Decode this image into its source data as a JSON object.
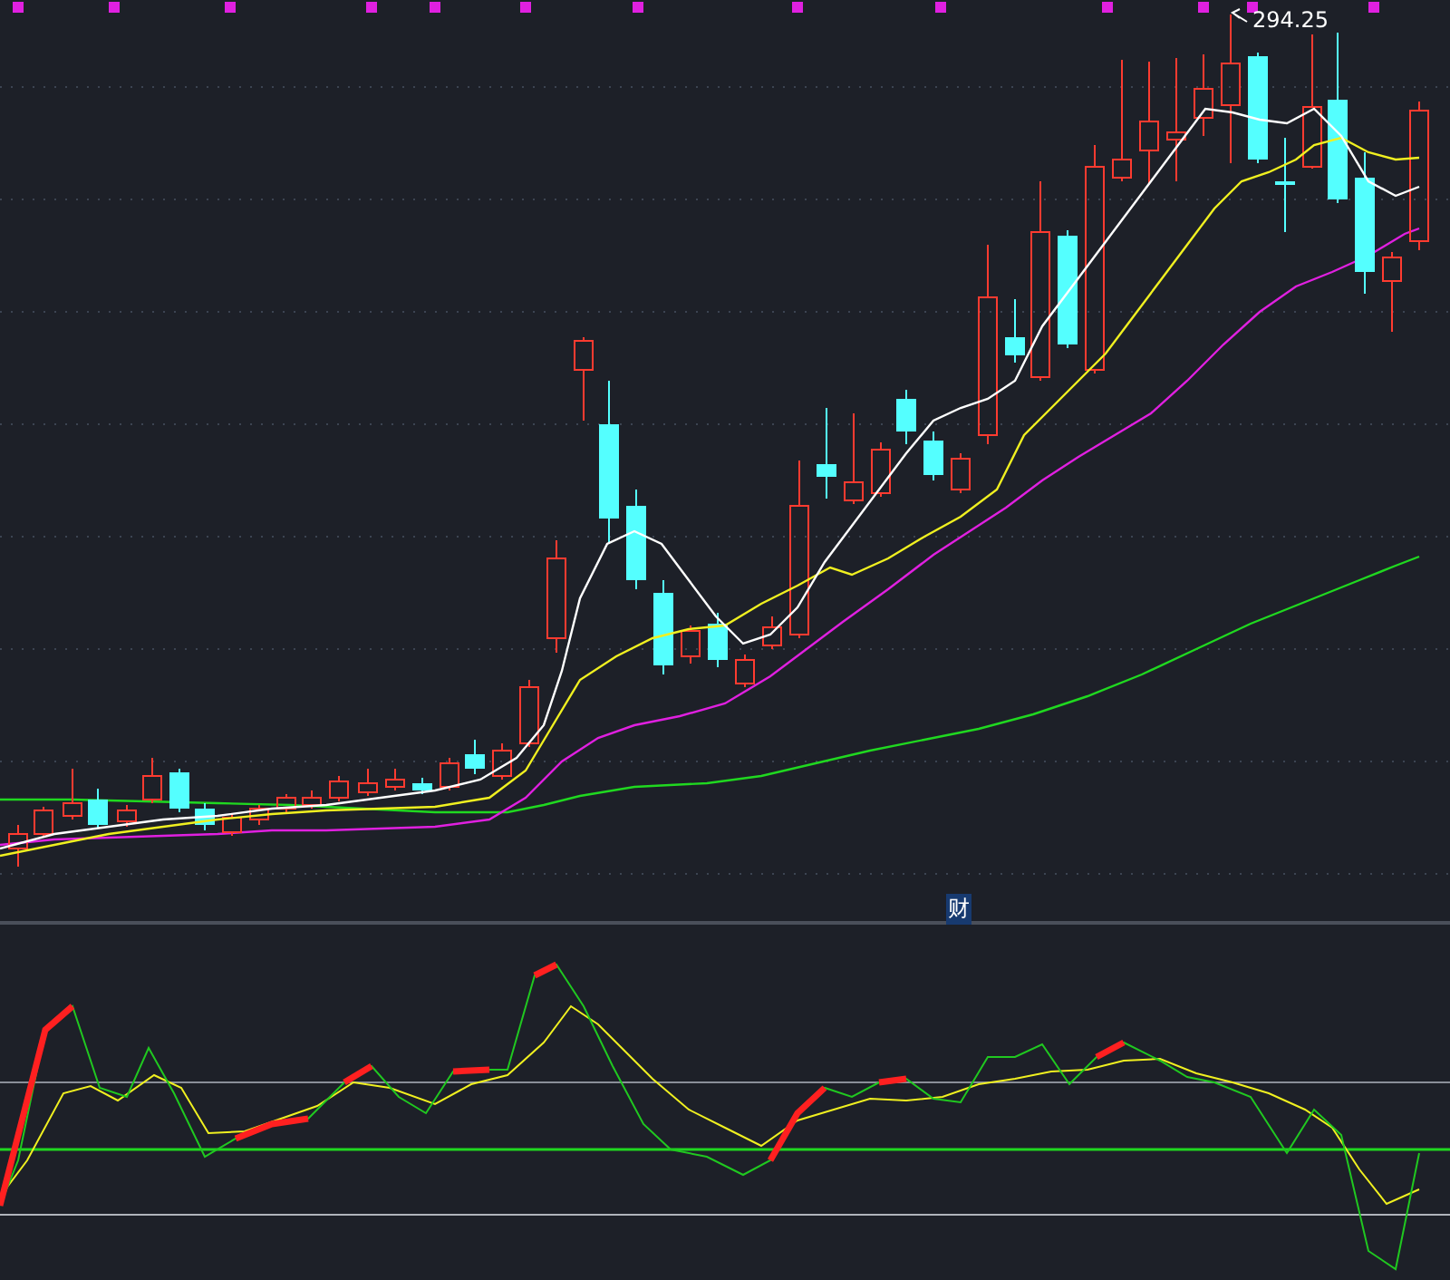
{
  "price_chart": {
    "high_label": "294.25"
  },
  "indicator_panel": {
    "label": "财"
  }
}
